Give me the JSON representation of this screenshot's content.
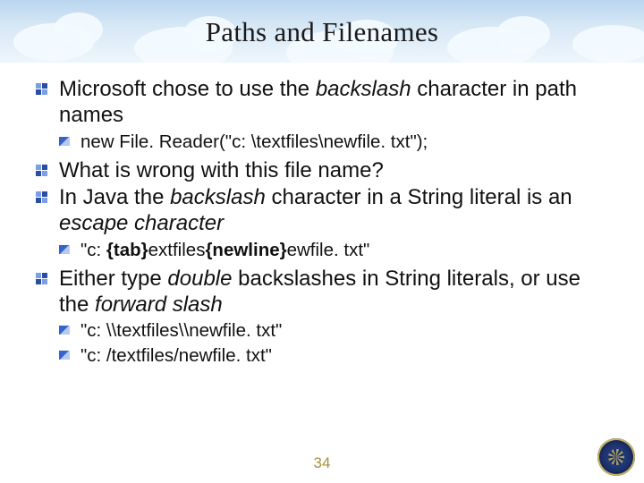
{
  "title": "Paths and Filenames",
  "bullets": {
    "b1a": "Microsoft chose to use the ",
    "b1b": "backslash",
    "b1c": " character in path names",
    "s1": "new File. Reader(\"c: \\textfiles\\newfile. txt\"); ",
    "b2": "What is wrong with this file name?",
    "b3a": "In Java the ",
    "b3b": "backslash",
    "b3c": " character in a String literal is an ",
    "b3d": "escape character",
    "s2a": "\"c: ",
    "s2b": "{tab}",
    "s2c": "extfiles",
    "s2d": "{newline}",
    "s2e": "ewfile. txt\"",
    "b4a": "Either type ",
    "b4b": "double",
    "b4c": " backslashes in String literals, or use the ",
    "b4d": "forward slash",
    "s3": "\"c: \\\\textfiles\\\\newfile. txt\"",
    "s4": "\"c: /textfiles/newfile. txt\""
  },
  "page_number": "34"
}
